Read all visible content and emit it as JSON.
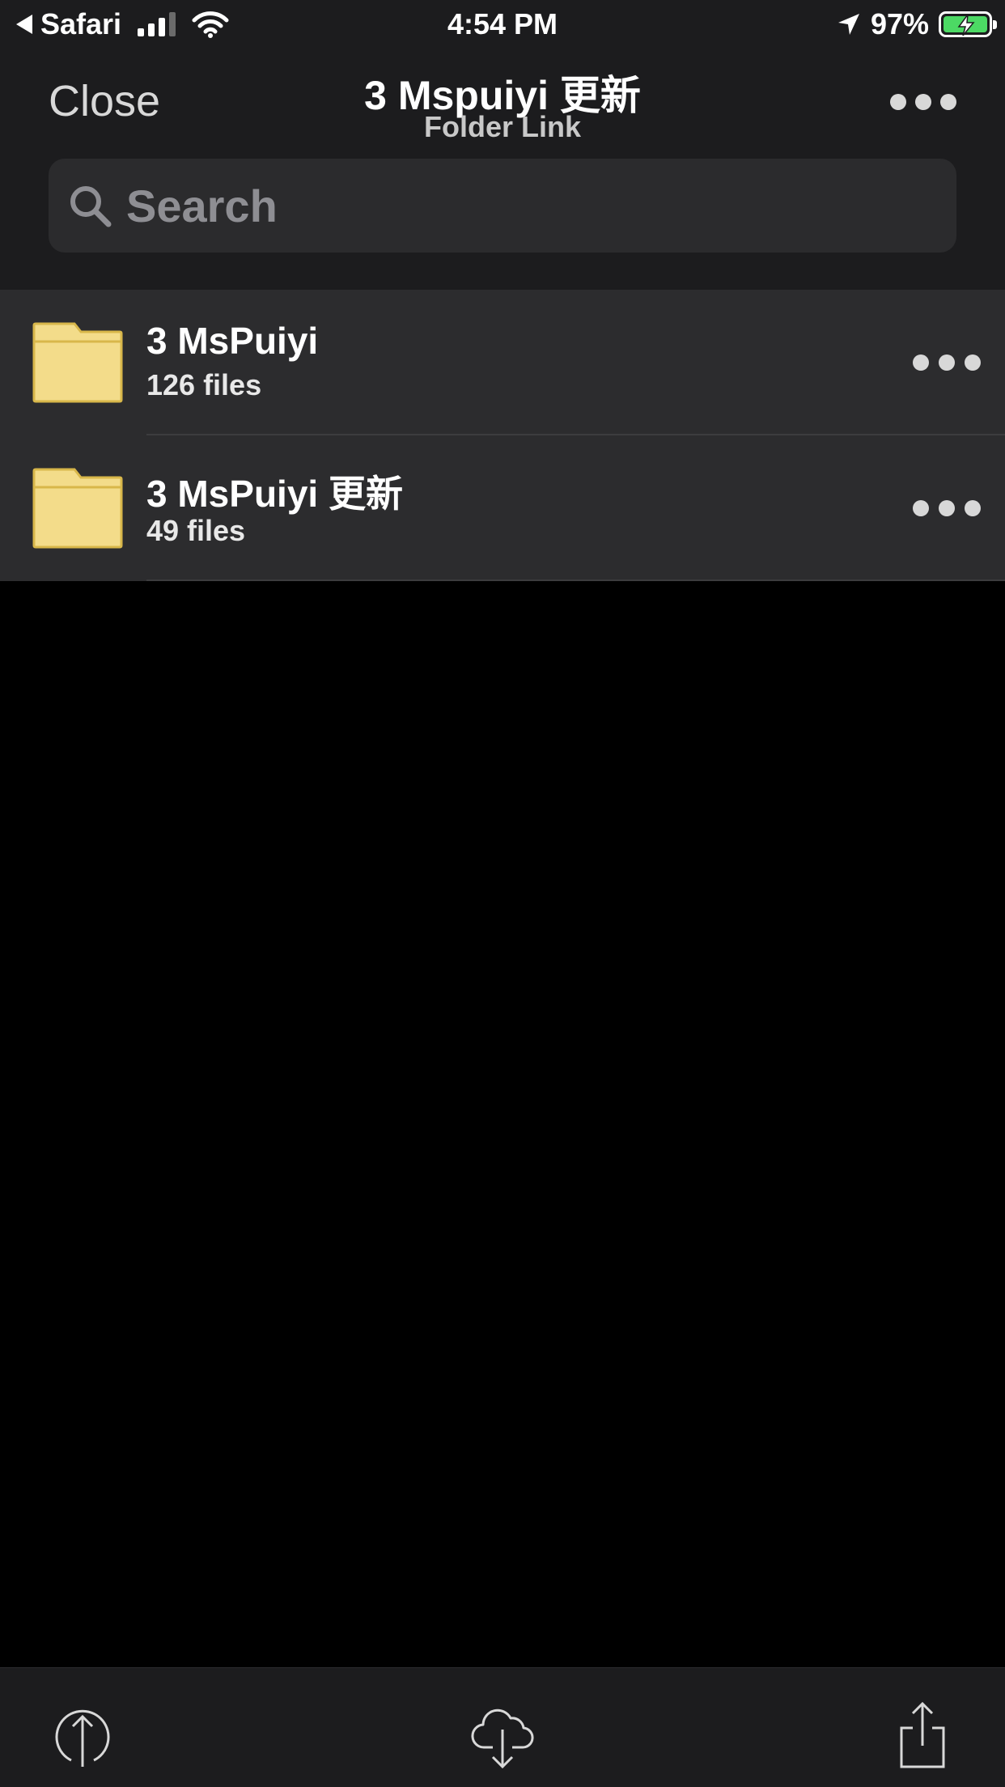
{
  "status_bar": {
    "back_app": "Safari",
    "time": "4:54 PM",
    "battery": "97%",
    "battery_level": 0.97,
    "icons": [
      "back-arrow-icon",
      "signal-icon",
      "wifi-icon",
      "location-icon",
      "battery-charging-icon"
    ]
  },
  "header": {
    "close_label": "Close",
    "title": "3 Mspuiyi 更新",
    "subtitle": "Folder Link",
    "more_icon": "more-dots-icon"
  },
  "search": {
    "placeholder": "Search",
    "value": ""
  },
  "folders": [
    {
      "name": "3 MsPuiyi",
      "count": "126 files"
    },
    {
      "name": "3 MsPuiyi 更新",
      "count": "49 files"
    }
  ],
  "toolbar": {
    "icons": [
      "upload-icon",
      "cloud-download-icon",
      "share-icon"
    ]
  },
  "colors": {
    "background": "#000000",
    "header_bg": "#1c1c1e",
    "row_bg": "#2c2c2e",
    "folder_yellow": "#f3dc8a",
    "battery_green": "#4cd964"
  }
}
